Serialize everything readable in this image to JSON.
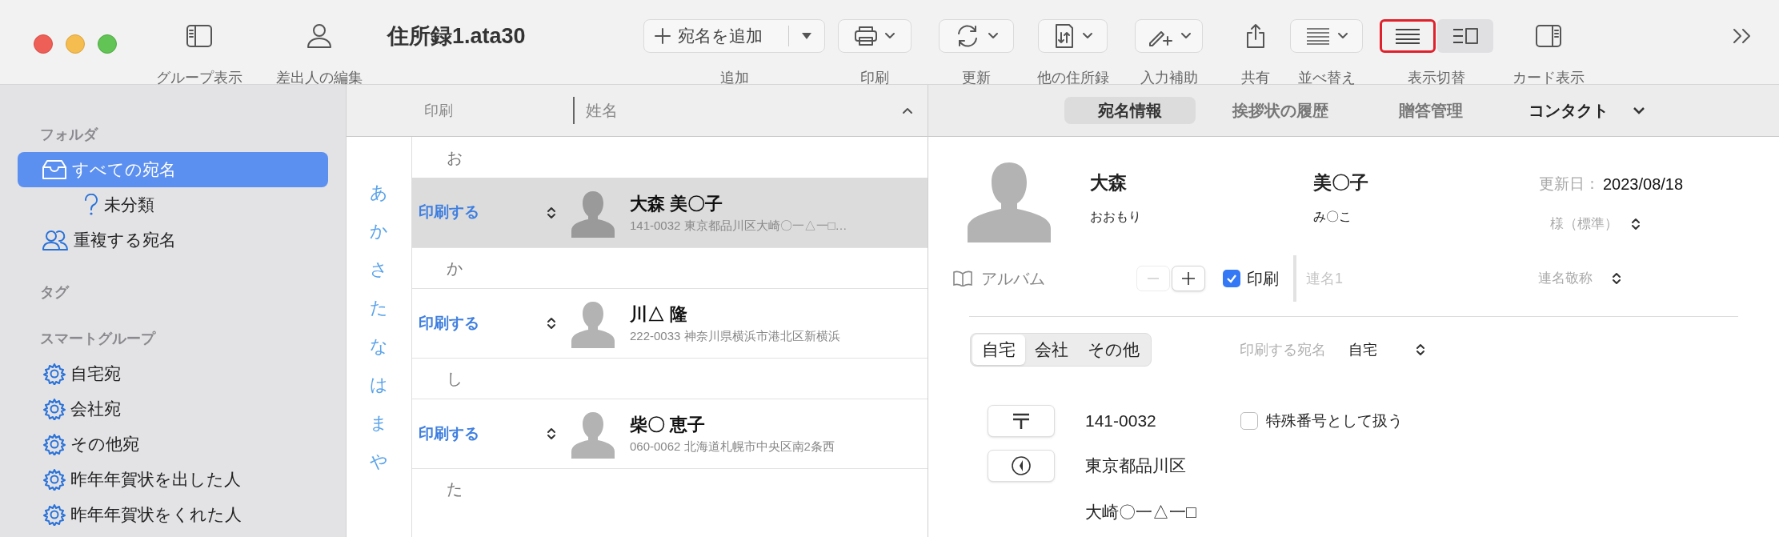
{
  "window": {
    "title": "住所録1.ata30"
  },
  "toolbar": {
    "left": [
      {
        "label": "グループ表示"
      },
      {
        "label": "差出人の編集"
      }
    ],
    "right": [
      {
        "kind": "split",
        "button": "宛名を追加",
        "label": "追加"
      },
      {
        "kind": "menu",
        "label": "印刷"
      },
      {
        "kind": "menu",
        "label": "更新"
      },
      {
        "kind": "menu",
        "label": "他の住所録"
      },
      {
        "kind": "menu",
        "label": "入力補助"
      },
      {
        "kind": "plain",
        "label": "共有"
      },
      {
        "kind": "menu",
        "label": "並べ替え"
      },
      {
        "kind": "segmented",
        "label": "表示切替",
        "segments": [
          {
            "selected": false,
            "highlighted": true
          },
          {
            "selected": true,
            "highlighted": false
          }
        ]
      },
      {
        "kind": "plain",
        "label": "カード表示"
      }
    ]
  },
  "sidebar": {
    "sections": [
      {
        "title": "フォルダ",
        "items": [
          {
            "kind": "all",
            "label": "すべての宛名",
            "selected": true,
            "children": [
              {
                "kind": "unfiled",
                "label": "未分類",
                "selected": false
              }
            ]
          },
          {
            "kind": "duplicates",
            "label": "重複する宛名",
            "selected": false
          }
        ]
      },
      {
        "title": "タグ"
      },
      {
        "title": "スマートグループ",
        "items": [
          {
            "kind": "smart",
            "label": "自宅宛",
            "selected": false
          },
          {
            "kind": "smart",
            "label": "会社宛",
            "selected": false
          },
          {
            "kind": "smart",
            "label": "その他宛",
            "selected": false
          },
          {
            "kind": "smart",
            "label": "昨年年賀状を出した人",
            "selected": false
          },
          {
            "kind": "smart",
            "label": "昨年年賀状をくれた人",
            "selected": false
          }
        ]
      }
    ]
  },
  "list": {
    "columns": [
      "印刷",
      "姓名"
    ],
    "index": [
      "あ",
      "か",
      "さ",
      "た",
      "な",
      "は",
      "ま",
      "や"
    ],
    "groups": [
      {
        "heading": "お",
        "rows": [
          {
            "print": "印刷する",
            "name": "大森 美〇子",
            "address": "141-0032 東京都品川区大崎〇一△一□…",
            "selected": true
          }
        ]
      },
      {
        "heading": "か",
        "rows": [
          {
            "print": "印刷する",
            "name": "川△ 隆",
            "address": "222-0033 神奈川県横浜市港北区新横浜",
            "selected": false
          }
        ]
      },
      {
        "heading": "し",
        "rows": [
          {
            "print": "印刷する",
            "name": "柴〇 恵子",
            "address": "060-0062 北海道札幌市中央区南2条西",
            "selected": false
          }
        ]
      },
      {
        "heading": "た"
      }
    ]
  },
  "detail": {
    "tabs": [
      {
        "kind": "tab",
        "label": "宛名情報",
        "selected": true
      },
      {
        "kind": "tab",
        "label": "挨拶状の履歴",
        "selected": false
      },
      {
        "kind": "tab",
        "label": "贈答管理",
        "selected": false
      },
      {
        "kind": "menu",
        "label": "コンタクト",
        "selected": false
      }
    ],
    "family_name": "大森",
    "given_name": "美〇子",
    "family_reading": "おおもり",
    "given_reading": "み〇こ",
    "updated_label": "更新日：",
    "updated": "2023/08/18",
    "honorific": "様（標準）",
    "album": "アルバム",
    "print_checkbox": {
      "label": "印刷",
      "checked": true
    },
    "joint_name": {
      "placeholder": "連名1"
    },
    "joint_honorific": "連名敬称",
    "address_tabs": [
      {
        "label": "自宅",
        "selected": true
      },
      {
        "label": "会社",
        "selected": false
      },
      {
        "label": "その他",
        "selected": false
      }
    ],
    "print_address_label": "印刷する宛名",
    "print_address_value": "自宅",
    "postal_code": "141-0032",
    "special_number": {
      "label": "特殊番号として扱う",
      "checked": false
    },
    "address_lines": [
      "東京都品川区",
      "大崎〇一△一□"
    ]
  }
}
